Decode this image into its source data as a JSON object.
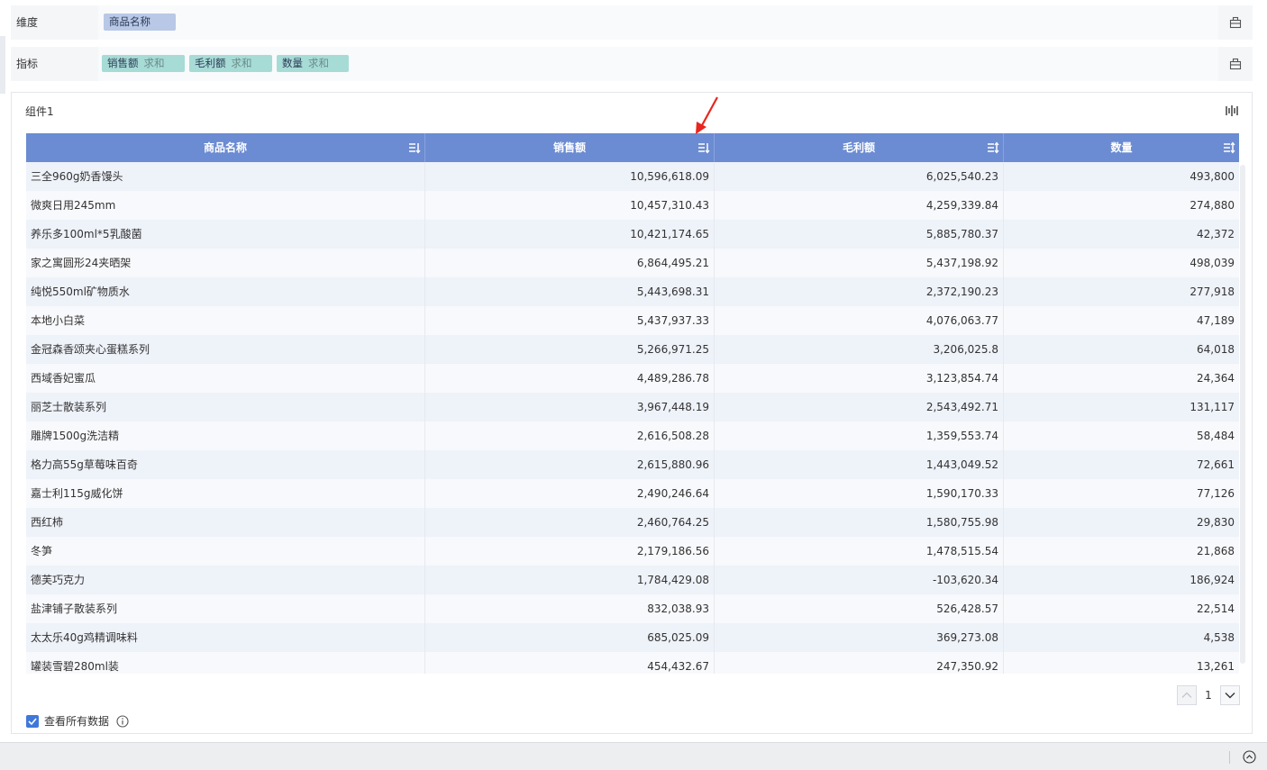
{
  "dimension_row": {
    "label": "维度",
    "pills": [
      {
        "label": "商品名称"
      }
    ],
    "tool_icon": "toolbox-icon"
  },
  "metric_row": {
    "label": "指标",
    "pills": [
      {
        "label": "销售额",
        "agg": "求和"
      },
      {
        "label": "毛利额",
        "agg": "求和"
      },
      {
        "label": "数量",
        "agg": "求和"
      }
    ],
    "tool_icon": "toolbox-icon"
  },
  "component": {
    "title": "组件1",
    "tool_icon": "chart-settings-icon"
  },
  "table": {
    "headers": [
      "商品名称",
      "销售额",
      "毛利额",
      "数量"
    ],
    "sort_icons": [
      "sort-icon",
      "sort-desc-icon",
      "sort-icon",
      "sort-icon"
    ],
    "rows": [
      [
        "三全960g奶香馒头",
        "10,596,618.09",
        "6,025,540.23",
        "493,800"
      ],
      [
        "微爽日用245mm",
        "10,457,310.43",
        "4,259,339.84",
        "274,880"
      ],
      [
        "养乐多100ml*5乳酸菌",
        "10,421,174.65",
        "5,885,780.37",
        "42,372"
      ],
      [
        "家之寓圆形24夹晒架",
        "6,864,495.21",
        "5,437,198.92",
        "498,039"
      ],
      [
        "纯悦550ml矿物质水",
        "5,443,698.31",
        "2,372,190.23",
        "277,918"
      ],
      [
        "本地小白菜",
        "5,437,937.33",
        "4,076,063.77",
        "47,189"
      ],
      [
        "金冠森香颂夹心蛋糕系列",
        "5,266,971.25",
        "3,206,025.8",
        "64,018"
      ],
      [
        "西域香妃蜜瓜",
        "4,489,286.78",
        "3,123,854.74",
        "24,364"
      ],
      [
        "丽芝士散装系列",
        "3,967,448.19",
        "2,543,492.71",
        "131,117"
      ],
      [
        "雕牌1500g洗洁精",
        "2,616,508.28",
        "1,359,553.74",
        "58,484"
      ],
      [
        "格力高55g草莓味百奇",
        "2,615,880.96",
        "1,443,049.52",
        "72,661"
      ],
      [
        "嘉士利115g威化饼",
        "2,490,246.64",
        "1,590,170.33",
        "77,126"
      ],
      [
        "西红柿",
        "2,460,764.25",
        "1,580,755.98",
        "29,830"
      ],
      [
        "冬笋",
        "2,179,186.56",
        "1,478,515.54",
        "21,868"
      ],
      [
        "德芙巧克力",
        "1,784,429.08",
        "-103,620.34",
        "186,924"
      ],
      [
        "盐津铺子散装系列",
        "832,038.93",
        "526,428.57",
        "22,514"
      ],
      [
        "太太乐40g鸡精调味料",
        "685,025.09",
        "369,273.08",
        "4,538"
      ],
      [
        "罐装雪碧280ml装",
        "454,432.67",
        "247,350.92",
        "13,261"
      ]
    ]
  },
  "pager": {
    "page": "1",
    "prev_icon": "chevron-up-icon",
    "next_icon": "chevron-down-icon"
  },
  "footer": {
    "show_all_label": "查看所有数据",
    "show_all_checked": true,
    "info_icon": "info-icon"
  },
  "bottom_bar": {
    "icon": "collapse-up-icon"
  },
  "colors": {
    "header": "#6b8bd2",
    "dim_pill": "#b8c8e6",
    "metric_pill": "#a7dbd6",
    "annotation": "#e8261f"
  }
}
